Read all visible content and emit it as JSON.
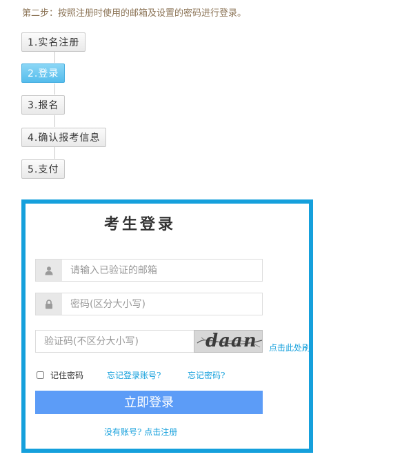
{
  "intro": "第二步：按照注册时使用的邮箱及设置的密码进行登录。",
  "steps": [
    {
      "label": "1.实名注册"
    },
    {
      "label": "2.登录"
    },
    {
      "label": "3.报名"
    },
    {
      "label": "4.确认报考信息"
    },
    {
      "label": "5.支付"
    }
  ],
  "active_step": 2,
  "login": {
    "title": "考生登录",
    "email_placeholder": "请输入已验证的邮箱",
    "password_placeholder": "密码(区分大小写)",
    "captcha_placeholder": "验证码(不区分大小写)",
    "captcha_text": "daan",
    "refresh_link": "点击此处刷",
    "remember_label": "记住密码",
    "forgot_account_link": "忘记登录账号?",
    "forgot_password_link": "忘记密码?",
    "submit_label": "立即登录",
    "register_link": "没有账号? 点击注册"
  },
  "colors": {
    "accent": "#15a0dc",
    "button": "#5c9cf7",
    "active_step": "#55bdec"
  },
  "icons": {
    "email_field": "user-icon",
    "password_field": "lock-icon"
  }
}
